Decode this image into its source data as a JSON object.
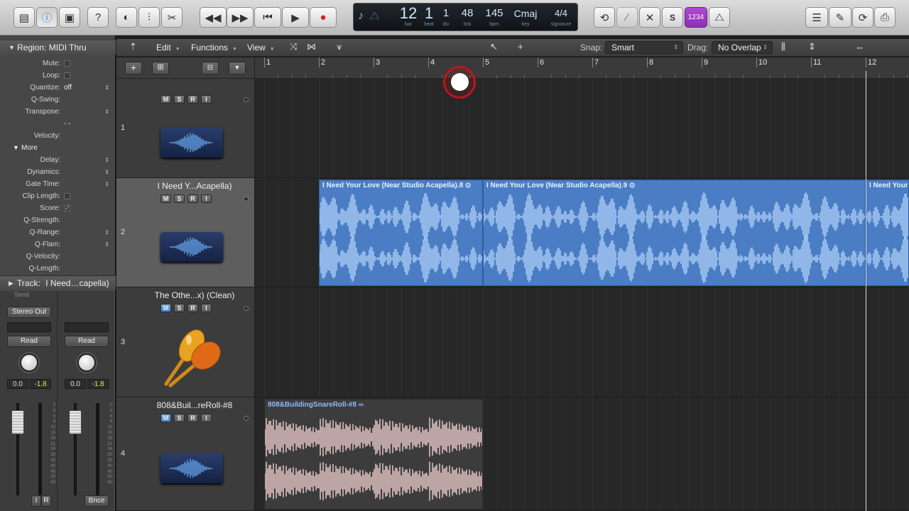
{
  "toolbar": {
    "left_buttons": [
      "library-icon",
      "info-icon",
      "toolbar-icon",
      "help-icon",
      "smart-controls-icon",
      "mixer-icon",
      "editors-icon"
    ],
    "transport": [
      "rewind-icon",
      "forward-icon",
      "go-to-start-icon",
      "play-icon",
      "record-icon"
    ],
    "lcd": {
      "bar": "12",
      "bar_label": "bar",
      "beat": "1",
      "beat_label": "beat",
      "div": "1",
      "div_label": "div",
      "tick": "48",
      "tick_label": "tick",
      "bpm": "145",
      "bpm_label": "bpm",
      "key": "Cmaj",
      "key_label": "key",
      "signature": "4/4",
      "signature_label": "signature"
    },
    "right_buttons": [
      "cycle-icon",
      "tuner-icon",
      "replace-icon"
    ],
    "solo_label": "S",
    "countin_label": "1234",
    "far_right": [
      "list-editor-icon",
      "notepad-icon",
      "loop-browser-icon",
      "browser-icon"
    ]
  },
  "inspector": {
    "region_header": "Region: MIDI Thru",
    "rows": [
      {
        "label": "Mute:",
        "value": "",
        "type": "check"
      },
      {
        "label": "Loop:",
        "value": "",
        "type": "check"
      },
      {
        "label": "Quantize:",
        "value": "off",
        "type": "select"
      },
      {
        "label": "Q-Swing:",
        "value": "",
        "type": "text"
      },
      {
        "label": "Transpose:",
        "value": "",
        "type": "select"
      },
      {
        "label": "",
        "value": "- -",
        "type": "text"
      },
      {
        "label": "Velocity:",
        "value": "",
        "type": "text"
      }
    ],
    "more_label": "More",
    "more_rows": [
      {
        "label": "Delay:",
        "value": "",
        "type": "select"
      },
      {
        "label": "Dynamics:",
        "value": "",
        "type": "select"
      },
      {
        "label": "Gate Time:",
        "value": "",
        "type": "select"
      },
      {
        "label": "Clip Length:",
        "value": "",
        "type": "check"
      },
      {
        "label": "Score:",
        "value": "✓",
        "type": "check-on"
      },
      {
        "label": "Q-Strength:",
        "value": "",
        "type": "text"
      },
      {
        "label": "Q-Range:",
        "value": "",
        "type": "select"
      },
      {
        "label": "Q-Flam:",
        "value": "",
        "type": "select"
      },
      {
        "label": "Q-Velocity:",
        "value": "",
        "type": "text"
      },
      {
        "label": "Q-Length:",
        "value": "",
        "type": "text"
      }
    ],
    "track_header_label": "Track:",
    "track_header_name": "I Need…capella)",
    "strip1": {
      "send": "Send",
      "output": "Stereo Out",
      "auto": "Read",
      "pan": "0.0",
      "gain": "-1.8",
      "footer_i": "I",
      "footer_r": "R"
    },
    "strip2": {
      "auto": "Read",
      "pan": "0.0",
      "gain": "-1.8",
      "footer": "Bnce"
    },
    "scale": [
      "0",
      "3",
      "6",
      "9",
      "12",
      "15",
      "18",
      "21",
      "24",
      "30",
      "35",
      "40",
      "45",
      "50",
      "60"
    ]
  },
  "tracks_toolbar": {
    "menus": [
      "Edit",
      "Functions",
      "View"
    ],
    "snap_label": "Snap:",
    "snap_value": "Smart",
    "drag_label": "Drag:",
    "drag_value": "No Overlap"
  },
  "ruler": {
    "bars": [
      "1",
      "2",
      "3",
      "4",
      "5",
      "6",
      "7",
      "8",
      "9",
      "10",
      "11",
      "12"
    ]
  },
  "tracks": [
    {
      "number": "1",
      "name": "",
      "buttons": [
        "M",
        "S",
        "R",
        "I"
      ],
      "icon": "audio-waveform-icon",
      "selected": false
    },
    {
      "number": "2",
      "name": "I Need Y...Acapella)",
      "buttons": [
        "M",
        "S",
        "R",
        "I"
      ],
      "icon": "audio-waveform-icon",
      "selected": true
    },
    {
      "number": "3",
      "name": "The Othe...x) (Clean)",
      "buttons": [
        "M",
        "S",
        "R",
        "I"
      ],
      "icon": "maracas-icon",
      "selected": false
    },
    {
      "number": "4",
      "name": "808&Buil...reRoll-#8",
      "buttons": [
        "M",
        "S",
        "R",
        "I"
      ],
      "icon": "audio-waveform-icon",
      "selected": false
    }
  ],
  "regions": [
    {
      "track": 2,
      "title": "I Need Your Love (Near Studio Acapella).8",
      "start_bar": 2.0,
      "end_bar": 5.0,
      "color": "#4a7dc3"
    },
    {
      "track": 2,
      "title": "I Need Your Love (Near Studio Acapella).9",
      "start_bar": 5.0,
      "end_bar": 12.0,
      "color": "#4a7dc3"
    },
    {
      "track": 2,
      "title": "I Need Your L",
      "start_bar": 12.0,
      "end_bar": 12.9,
      "color": "#4a7dc3"
    },
    {
      "track": 4,
      "title": "808&BuildingSnareRoll-#8",
      "start_bar": 1.0,
      "end_bar": 5.0,
      "color": "#3c3c3c"
    }
  ],
  "playhead_bar": 12.0
}
